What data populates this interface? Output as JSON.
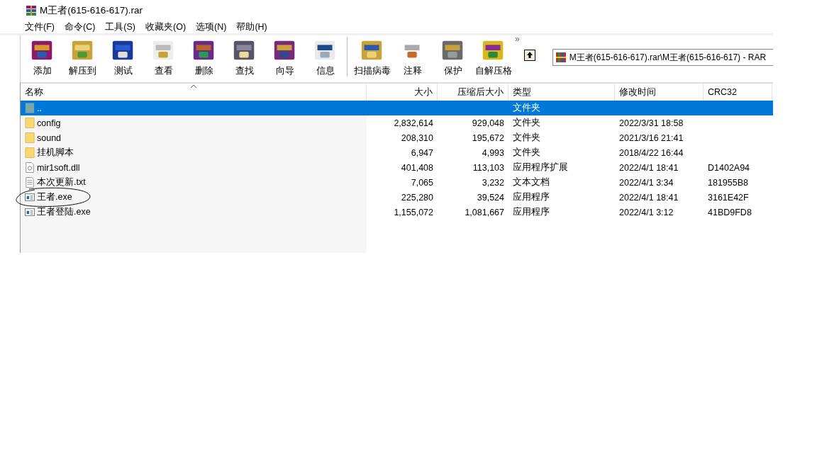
{
  "window": {
    "title": "M王者(615-616-617).rar"
  },
  "menu": [
    "文件(F)",
    "命令(C)",
    "工具(S)",
    "收藏夹(O)",
    "选项(N)",
    "帮助(H)"
  ],
  "toolbar": [
    [
      "添加",
      "解压到",
      "测试",
      "查看",
      "删除",
      "查找",
      "向导",
      "信息"
    ],
    [
      "扫描病毒",
      "注释",
      "保护",
      "自解压格"
    ]
  ],
  "toolbar_more": "»",
  "address": "M王者(615-616-617).rar\\M王者(615-616-617) - RAR",
  "table": {
    "columns": [
      "名称",
      "大小",
      "压缩后大小",
      "类型",
      "修改时间",
      "CRC32"
    ],
    "rows": [
      {
        "kind": "up",
        "name": "..",
        "size": "",
        "packed": "",
        "type": "文件夹",
        "modified": "",
        "crc": "",
        "selected": true
      },
      {
        "kind": "folder",
        "name": "config",
        "size": "2,832,614",
        "packed": "929,048",
        "type": "文件夹",
        "modified": "2022/3/31 18:58",
        "crc": "",
        "selected": false
      },
      {
        "kind": "folder",
        "name": "sound",
        "size": "208,310",
        "packed": "195,672",
        "type": "文件夹",
        "modified": "2021/3/16 21:41",
        "crc": "",
        "selected": false
      },
      {
        "kind": "folder",
        "name": "挂机脚本",
        "size": "6,947",
        "packed": "4,993",
        "type": "文件夹",
        "modified": "2018/4/22 16:44",
        "crc": "",
        "selected": false
      },
      {
        "kind": "dll",
        "name": "mir1soft.dll",
        "size": "401,408",
        "packed": "113,103",
        "type": "应用程序扩展",
        "modified": "2022/4/1 18:41",
        "crc": "D1402A94",
        "selected": false
      },
      {
        "kind": "txt",
        "name": "本次更新.txt",
        "size": "7,065",
        "packed": "3,232",
        "type": "文本文档",
        "modified": "2022/4/1 3:34",
        "crc": "181955B8",
        "selected": false
      },
      {
        "kind": "exe",
        "name": "王者.exe",
        "size": "225,280",
        "packed": "39,524",
        "type": "应用程序",
        "modified": "2022/4/1 18:41",
        "crc": "3161E42F",
        "selected": false
      },
      {
        "kind": "exe",
        "name": "王者登陆.exe",
        "size": "1,155,072",
        "packed": "1,081,667",
        "type": "应用程序",
        "modified": "2022/4/1 3:12",
        "crc": "41BD9FD8",
        "selected": false
      }
    ]
  }
}
